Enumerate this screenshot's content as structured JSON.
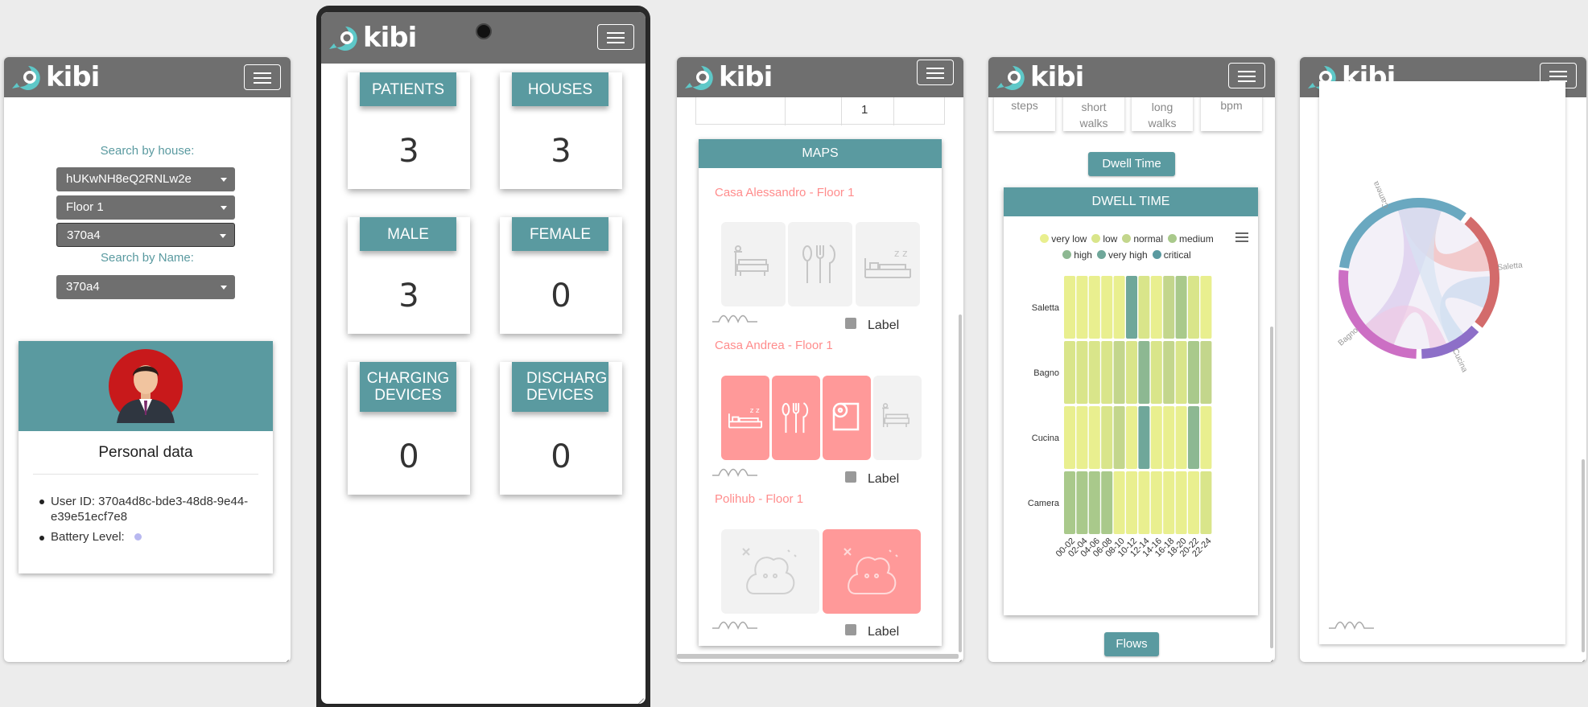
{
  "brand": {
    "name": "kibi",
    "accent": "#5a9aa0",
    "bar_color": "#6f6f6f"
  },
  "panel1": {
    "search_house_label": "Search by house:",
    "house_select": "hUKwNH8eQ2RNLw2e",
    "floor_select": "Floor 1",
    "device_select": "370a4",
    "search_name_label": "Search by Name:",
    "name_select": "370a4",
    "personal_title": "Personal data",
    "user_id_label": "User ID: 370a4d8c-bde3-48d8-9e44-",
    "user_id_cont": "e39e51ecf7e8",
    "battery_label": "Battery Level:"
  },
  "panel2": {
    "stats": [
      {
        "label": "PATIENTS",
        "value": "3"
      },
      {
        "label": "HOUSES",
        "value": "3"
      },
      {
        "label": "MALE",
        "value": "3"
      },
      {
        "label": "FEMALE",
        "value": "0"
      },
      {
        "label1": "CHARGING",
        "label2": "DEVICES",
        "value": "0"
      },
      {
        "label1": "DISCHARGING",
        "label2": "DEVICES",
        "value": "0"
      }
    ]
  },
  "panel3": {
    "table_cell": "1",
    "maps_title": "MAPS",
    "maps": [
      {
        "title": "Casa Alessandro - Floor 1",
        "checkbox_label": "Label"
      },
      {
        "title": "Casa Andrea - Floor 1",
        "checkbox_label": "Label"
      },
      {
        "title": "Polihub - Floor 1",
        "checkbox_label": "Label"
      }
    ]
  },
  "panel4": {
    "metric_labels": [
      "steps",
      "short",
      "walks",
      "long",
      "walks",
      "bpm"
    ],
    "dwell_button": "Dwell Time",
    "dwell_title": "DWELL TIME",
    "flows_button": "Flows",
    "chart_data": {
      "type": "heatmap",
      "title": "DWELL TIME",
      "legend": [
        {
          "name": "very low",
          "color": "#e9ef8f"
        },
        {
          "name": "low",
          "color": "#d9e58a"
        },
        {
          "name": "normal",
          "color": "#c3d68c"
        },
        {
          "name": "medium",
          "color": "#a9c98b"
        },
        {
          "name": "high",
          "color": "#8db892"
        },
        {
          "name": "very high",
          "color": "#6fa79a"
        },
        {
          "name": "critical",
          "color": "#5a9aa0"
        }
      ],
      "rows": [
        "Saletta",
        "Bagno",
        "Cucina",
        "Camera"
      ],
      "columns": [
        "00-02",
        "02-04",
        "04-06",
        "06-08",
        "08-10",
        "10-12",
        "12-14",
        "14-16",
        "16-18",
        "18-20",
        "20-22",
        "22-24"
      ],
      "values": [
        [
          0,
          0,
          0,
          0,
          0,
          5,
          1,
          0,
          2,
          3,
          1,
          0
        ],
        [
          1,
          1,
          1,
          1,
          2,
          1,
          4,
          1,
          2,
          1,
          3,
          2
        ],
        [
          0,
          0,
          0,
          1,
          2,
          0,
          5,
          0,
          0,
          0,
          4,
          0
        ],
        [
          3,
          3,
          3,
          3,
          0,
          0,
          0,
          0,
          0,
          0,
          0,
          1
        ]
      ]
    }
  },
  "panel5": {
    "chart_data": {
      "type": "chord",
      "nodes": [
        {
          "name": "Camera",
          "color": "#6aa8c0"
        },
        {
          "name": "Saletta",
          "color": "#d36b6b"
        },
        {
          "name": "Cucina",
          "color": "#8d6fc8"
        },
        {
          "name": "Bagno",
          "color": "#cc6fc4"
        }
      ]
    }
  }
}
